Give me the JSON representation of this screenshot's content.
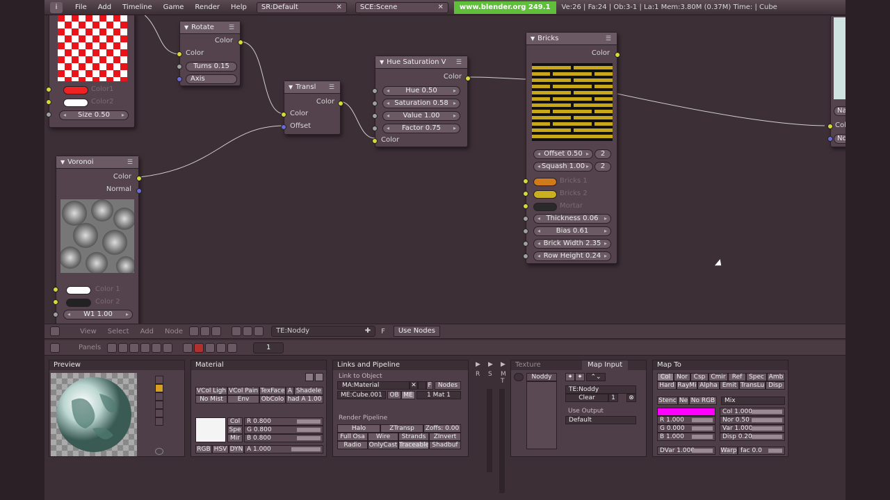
{
  "topbar": {
    "menus": [
      "File",
      "Add",
      "Timeline",
      "Game",
      "Render",
      "Help"
    ],
    "screen": "SR:Default",
    "scene": "SCE:Scene",
    "url": "www.blender.org 249.1",
    "stats": "Ve:26 | Fa:24 | Ob:3-1 | La:1   Mem:3.80M (0.37M)   Time:  | Cube"
  },
  "nodes": {
    "texture_preview": {
      "color1": "Color1",
      "color2": "Color2",
      "size": "Size 0.50",
      "color1_hex": "#ee2222",
      "color2_hex": "#ffffff"
    },
    "rotate": {
      "title": "Rotate",
      "out_color": "Color",
      "in_color": "Color",
      "turns": "Turns 0.15",
      "axis": "Axis"
    },
    "translate": {
      "title": "Transl",
      "out_color": "Color",
      "in_color": "Color",
      "offset": "Offset"
    },
    "hue_sat": {
      "title": "Hue Saturation V",
      "out_color": "Color",
      "hue": "Hue 0.50",
      "saturation": "Saturation 0.58",
      "value": "Value 1.00",
      "factor": "Factor 0.75",
      "in_color": "Color"
    },
    "bricks": {
      "title": "Bricks",
      "out_color": "Color",
      "offset": "Offset 0.50",
      "offset_freq": "2",
      "squash": "Squash 1.00",
      "squash_freq": "2",
      "bricks1": "Bricks 1",
      "bricks2": "Bricks 2",
      "mortar": "Mortar",
      "bricks1_hex": "#d07a1a",
      "bricks2_hex": "#c8b020",
      "mortar_hex": "#2a2a2a",
      "thickness": "Thickness 0.06",
      "bias": "Bias 0.61",
      "brick_width": "Brick Width 2.35",
      "row_height": "Row Height 0.24"
    },
    "voronoi": {
      "title": "Voronoi",
      "out_color": "Color",
      "out_normal": "Normal",
      "color1": "Color 1",
      "color2": "Color 2",
      "w1": "W1 1.00"
    },
    "right_node": {
      "out_color": "Colo",
      "out_normal": "Nor",
      "name": "Nan"
    }
  },
  "ne_header": {
    "view": "View",
    "select": "Select",
    "add": "Add",
    "node": "Node",
    "texture": "TE:Noddy",
    "f": "F",
    "use_nodes": "Use Nodes"
  },
  "btn_header": {
    "panels": "Panels",
    "frame": "1"
  },
  "preview": {
    "title": "Preview"
  },
  "material": {
    "title": "Material",
    "row1": [
      "VCol Ligh",
      "VCol Pain",
      "TexFace",
      "A",
      "Shadele"
    ],
    "row2": [
      "No Mist",
      "Env",
      "ObColo",
      "had A 1.00"
    ],
    "tabs": [
      "Col",
      "Spe",
      "Mir"
    ],
    "r": "R 0.800",
    "g": "G 0.800",
    "b": "B 0.800",
    "modes": [
      "RGB",
      "HSV",
      "DYN"
    ],
    "a": "A 1.000"
  },
  "links": {
    "title": "Links and Pipeline",
    "link_to_object": "Link to Object",
    "ma": "MA:Material",
    "f": "F",
    "nodes": "Nodes",
    "me": "ME:Cube.001",
    "ob": "OB",
    "me_btn": "ME",
    "mat": "1 Mat 1",
    "render_pipeline": "Render Pipeline",
    "rp1": [
      "Halo",
      "ZTransp",
      "Zoffs: 0.00"
    ],
    "rp2": [
      "Full Osa",
      "Wire",
      "Strands",
      "ZInvert"
    ],
    "rp3": [
      "Radio",
      "OnlyCast",
      "Traceable",
      "Shadbuf"
    ],
    "side": [
      "R",
      "S",
      "M",
      "T"
    ]
  },
  "texture": {
    "title": "Texture",
    "map_input": "Map Input",
    "slot": "Noddy",
    "te": "TE:Noddy",
    "clear": "Clear",
    "num": "1",
    "use_output": "Use Output",
    "default": "Default"
  },
  "mapto": {
    "title": "Map To",
    "row1": [
      "Col",
      "Nor",
      "Csp",
      "Cmir",
      "Ref",
      "Spec",
      "Amb"
    ],
    "row2": [
      "Hard",
      "RayMi",
      "Alpha",
      "Emit",
      "TransLu",
      "Disp"
    ],
    "row3": [
      "Stenc",
      "Ne",
      "No RGB"
    ],
    "mix": "Mix",
    "swatch_hex": "#ff00ff",
    "col": "Col 1.000",
    "nor": "Nor 0.50",
    "var": "Var 1.000",
    "disp": "Disp 0.20",
    "r": "R 1.000",
    "g": "G 0.000",
    "b": "B 1.000",
    "dvar": "DVar 1.000",
    "warp": "Warp",
    "fac": "fac 0.0"
  }
}
